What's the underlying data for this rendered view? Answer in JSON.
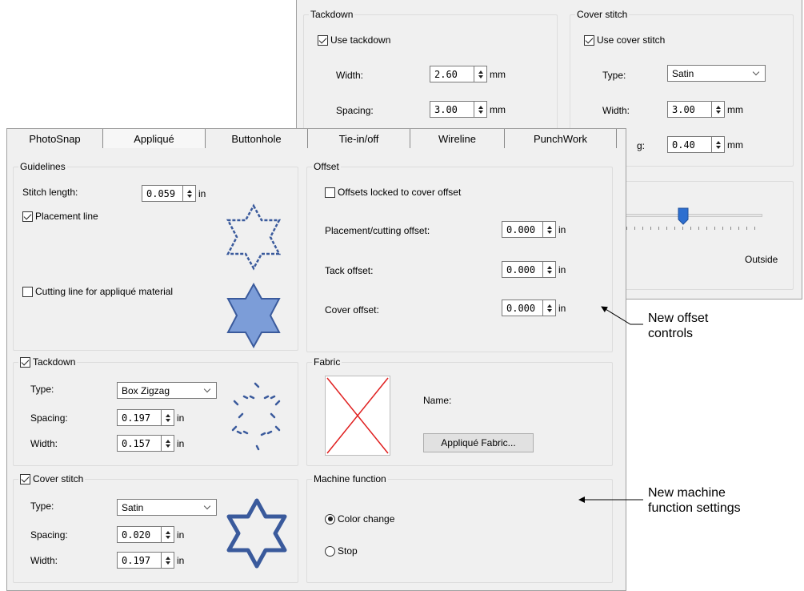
{
  "back_panel": {
    "tackdown": {
      "title": "Tackdown",
      "use_label": "Use tackdown",
      "width_label": "Width:",
      "width_value": "2.60",
      "spacing_label": "Spacing:",
      "spacing_value": "3.00",
      "unit": "mm"
    },
    "cover": {
      "title": "Cover stitch",
      "use_label": "Use cover stitch",
      "type_label": "Type:",
      "type_value": "Satin",
      "width_label": "Width:",
      "width_value": "3.00",
      "partial_label": "g:",
      "partial_value": "0.40",
      "unit": "mm"
    },
    "slider_label": "Outside"
  },
  "tabs": [
    "PhotoSnap",
    "Appliqué",
    "Buttonhole",
    "Tie-in/off",
    "Wireline",
    "PunchWork"
  ],
  "guidelines": {
    "title": "Guidelines",
    "stitch_length_label": "Stitch length:",
    "stitch_length_value": "0.059",
    "unit": "in",
    "placement_line_label": "Placement line",
    "cutting_line_label": "Cutting line for appliqué material"
  },
  "offset": {
    "title": "Offset",
    "locked_label": "Offsets locked to cover offset",
    "placement_cutting_label": "Placement/cutting offset:",
    "placement_cutting_value": "0.000",
    "tack_label": "Tack offset:",
    "tack_value": "0.000",
    "cover_label": "Cover offset:",
    "cover_value": "0.000",
    "unit": "in"
  },
  "tackdown": {
    "title": "Tackdown",
    "type_label": "Type:",
    "type_value": "Box Zigzag",
    "spacing_label": "Spacing:",
    "spacing_value": "0.197",
    "width_label": "Width:",
    "width_value": "0.157",
    "unit": "in"
  },
  "fabric": {
    "title": "Fabric",
    "name_label": "Name:",
    "button_label": "Appliqué Fabric..."
  },
  "cover_stitch": {
    "title": "Cover stitch",
    "type_label": "Type:",
    "type_value": "Satin",
    "spacing_label": "Spacing:",
    "spacing_value": "0.020",
    "width_label": "Width:",
    "width_value": "0.197",
    "unit": "in"
  },
  "machine_function": {
    "title": "Machine function",
    "color_change_label": "Color change",
    "stop_label": "Stop"
  },
  "callouts": {
    "offset": "New offset\ncontrols",
    "machine": "New machine\nfunction settings"
  },
  "colors": {
    "panel_bg": "#f0f0f0",
    "group_border": "#dcdcdc",
    "star_fill": "#7c9dd8",
    "star_stroke": "#3a5a9c",
    "slider_thumb": "#2d6fd0",
    "fabric_x": "#e02020"
  }
}
